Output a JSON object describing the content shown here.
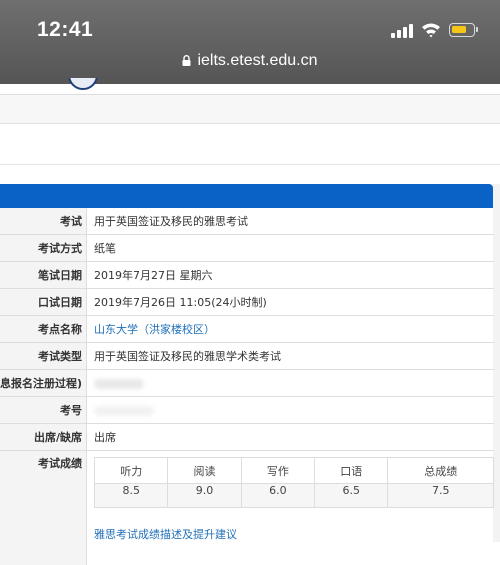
{
  "status_bar": {
    "time": "12:41"
  },
  "browser": {
    "url": "ielts.etest.edu.cn"
  },
  "details": [
    {
      "label": "考试",
      "value": "用于英国签证及移民的雅思考试"
    },
    {
      "label": "考试方式",
      "value": "纸笔"
    },
    {
      "label": "笔试日期",
      "value": "2019年7月27日 星期六"
    },
    {
      "label": "口试日期",
      "value": "2019年7月26日 11:05(24小时制)"
    },
    {
      "label": "考点名称",
      "value": "山东大学（洪家楼校区）"
    },
    {
      "label": "考试类型",
      "value": "用于英国签证及移民的雅思学术类考试"
    },
    {
      "label": "息报名注册过程)",
      "value": ""
    },
    {
      "label": "考号",
      "value": ""
    },
    {
      "label": "出席/缺席",
      "value": "出席"
    }
  ],
  "scores": {
    "label": "考试成绩",
    "headers": [
      "听力",
      "阅读",
      "写作",
      "口语",
      "总成绩"
    ],
    "values": [
      "8.5",
      "9.0",
      "6.0",
      "6.5",
      "7.5"
    ],
    "advice_link": "雅思考试成绩描述及提升建议"
  },
  "colors": {
    "header_blue": "#0a62c7",
    "link_blue": "#1f6fb8",
    "battery": "#f5c518"
  }
}
